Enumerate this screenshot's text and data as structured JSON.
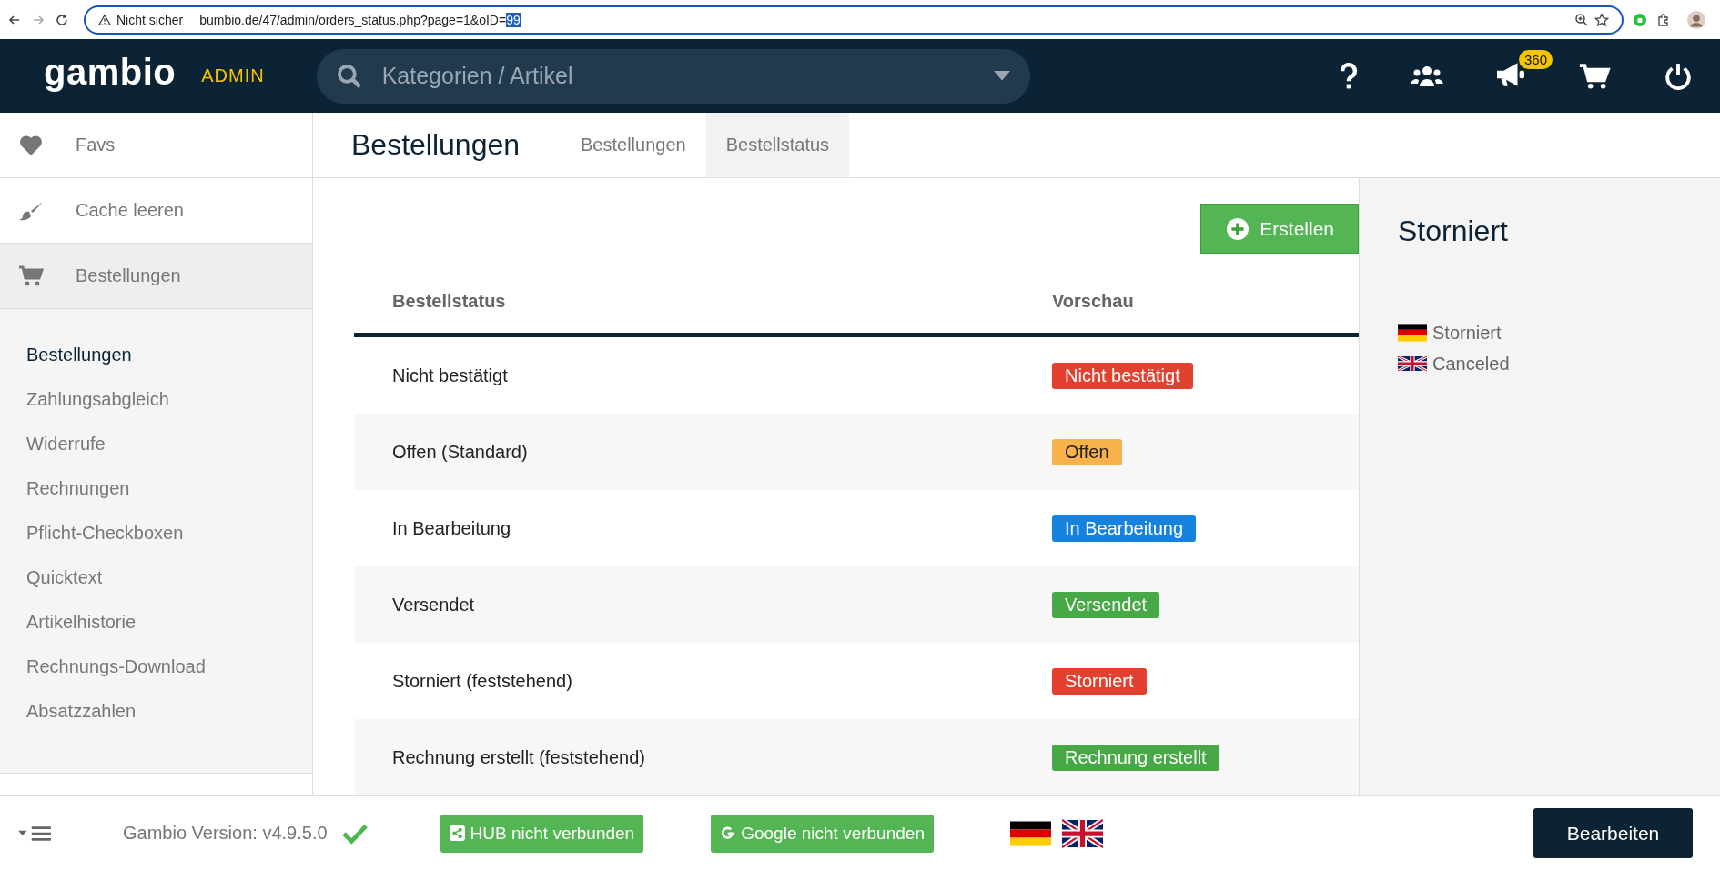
{
  "browser": {
    "security": "Nicht sicher",
    "url": "bumbio.de/47/admin/orders_status.php?page=1&oID=",
    "url_selection": "99"
  },
  "header": {
    "logo": "gambio",
    "product": "ADMIN",
    "search": {
      "placeholder": "Kategorien / Artikel"
    },
    "notification_count": "360"
  },
  "sidebar": {
    "top_items": [
      {
        "kind": "heart",
        "label": "Favs",
        "selected": false
      },
      {
        "kind": "brush",
        "label": "Cache leeren",
        "selected": false
      },
      {
        "kind": "cart",
        "label": "Bestellungen",
        "selected": true
      }
    ],
    "sub_items": [
      {
        "label": "Bestellungen",
        "selected": true
      },
      {
        "label": "Zahlungsabgleich",
        "selected": false
      },
      {
        "label": "Widerrufe",
        "selected": false
      },
      {
        "label": "Rechnungen",
        "selected": false
      },
      {
        "label": "Pflicht-Checkboxen",
        "selected": false
      },
      {
        "label": "Quicktext",
        "selected": false
      },
      {
        "label": "Artikelhistorie",
        "selected": false
      },
      {
        "label": "Rechnungs-Download",
        "selected": false
      },
      {
        "label": "Absatzzahlen",
        "selected": false
      }
    ]
  },
  "page": {
    "title": "Bestellungen",
    "tabs": [
      {
        "label": "Bestellungen",
        "selected": false
      },
      {
        "label": "Bestellstatus",
        "selected": true
      }
    ]
  },
  "create_button": "Erstellen",
  "table": {
    "columns": [
      "Bestellstatus",
      "Vorschau"
    ],
    "rows": [
      {
        "name": "Nicht bestätigt",
        "preview": "Nicht bestätigt",
        "color": "#e2412f"
      },
      {
        "name": "Offen (Standard)",
        "preview": "Offen",
        "color": "#f7b24a"
      },
      {
        "name": "In Bearbeitung",
        "preview": "In Bearbeitung",
        "color": "#1682e0"
      },
      {
        "name": "Versendet",
        "preview": "Versendet",
        "color": "#46a945"
      },
      {
        "name": "Storniert (feststehend)",
        "preview": "Storniert",
        "color": "#e2412f"
      },
      {
        "name": "Rechnung erstellt (feststehend)",
        "preview": "Rechnung erstellt",
        "color": "#46a945"
      }
    ]
  },
  "detail": {
    "title": "Storniert",
    "names": [
      {
        "kind": "de",
        "text": "Storniert"
      },
      {
        "kind": "en",
        "text": "Canceled"
      }
    ]
  },
  "footer": {
    "version": "Gambio Version: v4.9.5.0",
    "hub": "HUB nicht verbunden",
    "google": "Google nicht verbunden",
    "languages": [
      {
        "kind": "de"
      },
      {
        "kind": "en"
      }
    ],
    "edit_button": "Bearbeiten"
  }
}
